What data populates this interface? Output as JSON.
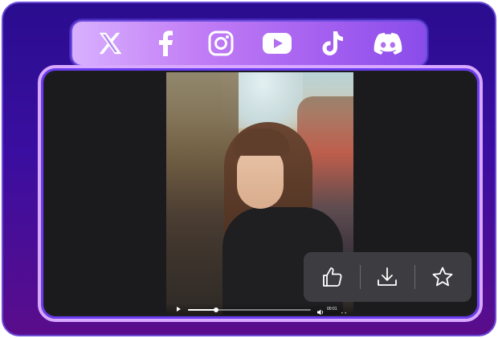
{
  "social": {
    "icons": [
      "x-icon",
      "facebook-icon",
      "instagram-icon",
      "youtube-icon",
      "tiktok-icon",
      "discord-icon"
    ]
  },
  "player": {
    "progress": 0.23,
    "time": "00:01"
  },
  "actions": {
    "icons": [
      "thumbs-up-icon",
      "download-icon",
      "star-icon"
    ]
  },
  "colors": {
    "background": "#2a0d8f",
    "social_bar": "#c27ef5",
    "player_border": "#d9a8ff",
    "action_panel": "#3d3d41"
  }
}
